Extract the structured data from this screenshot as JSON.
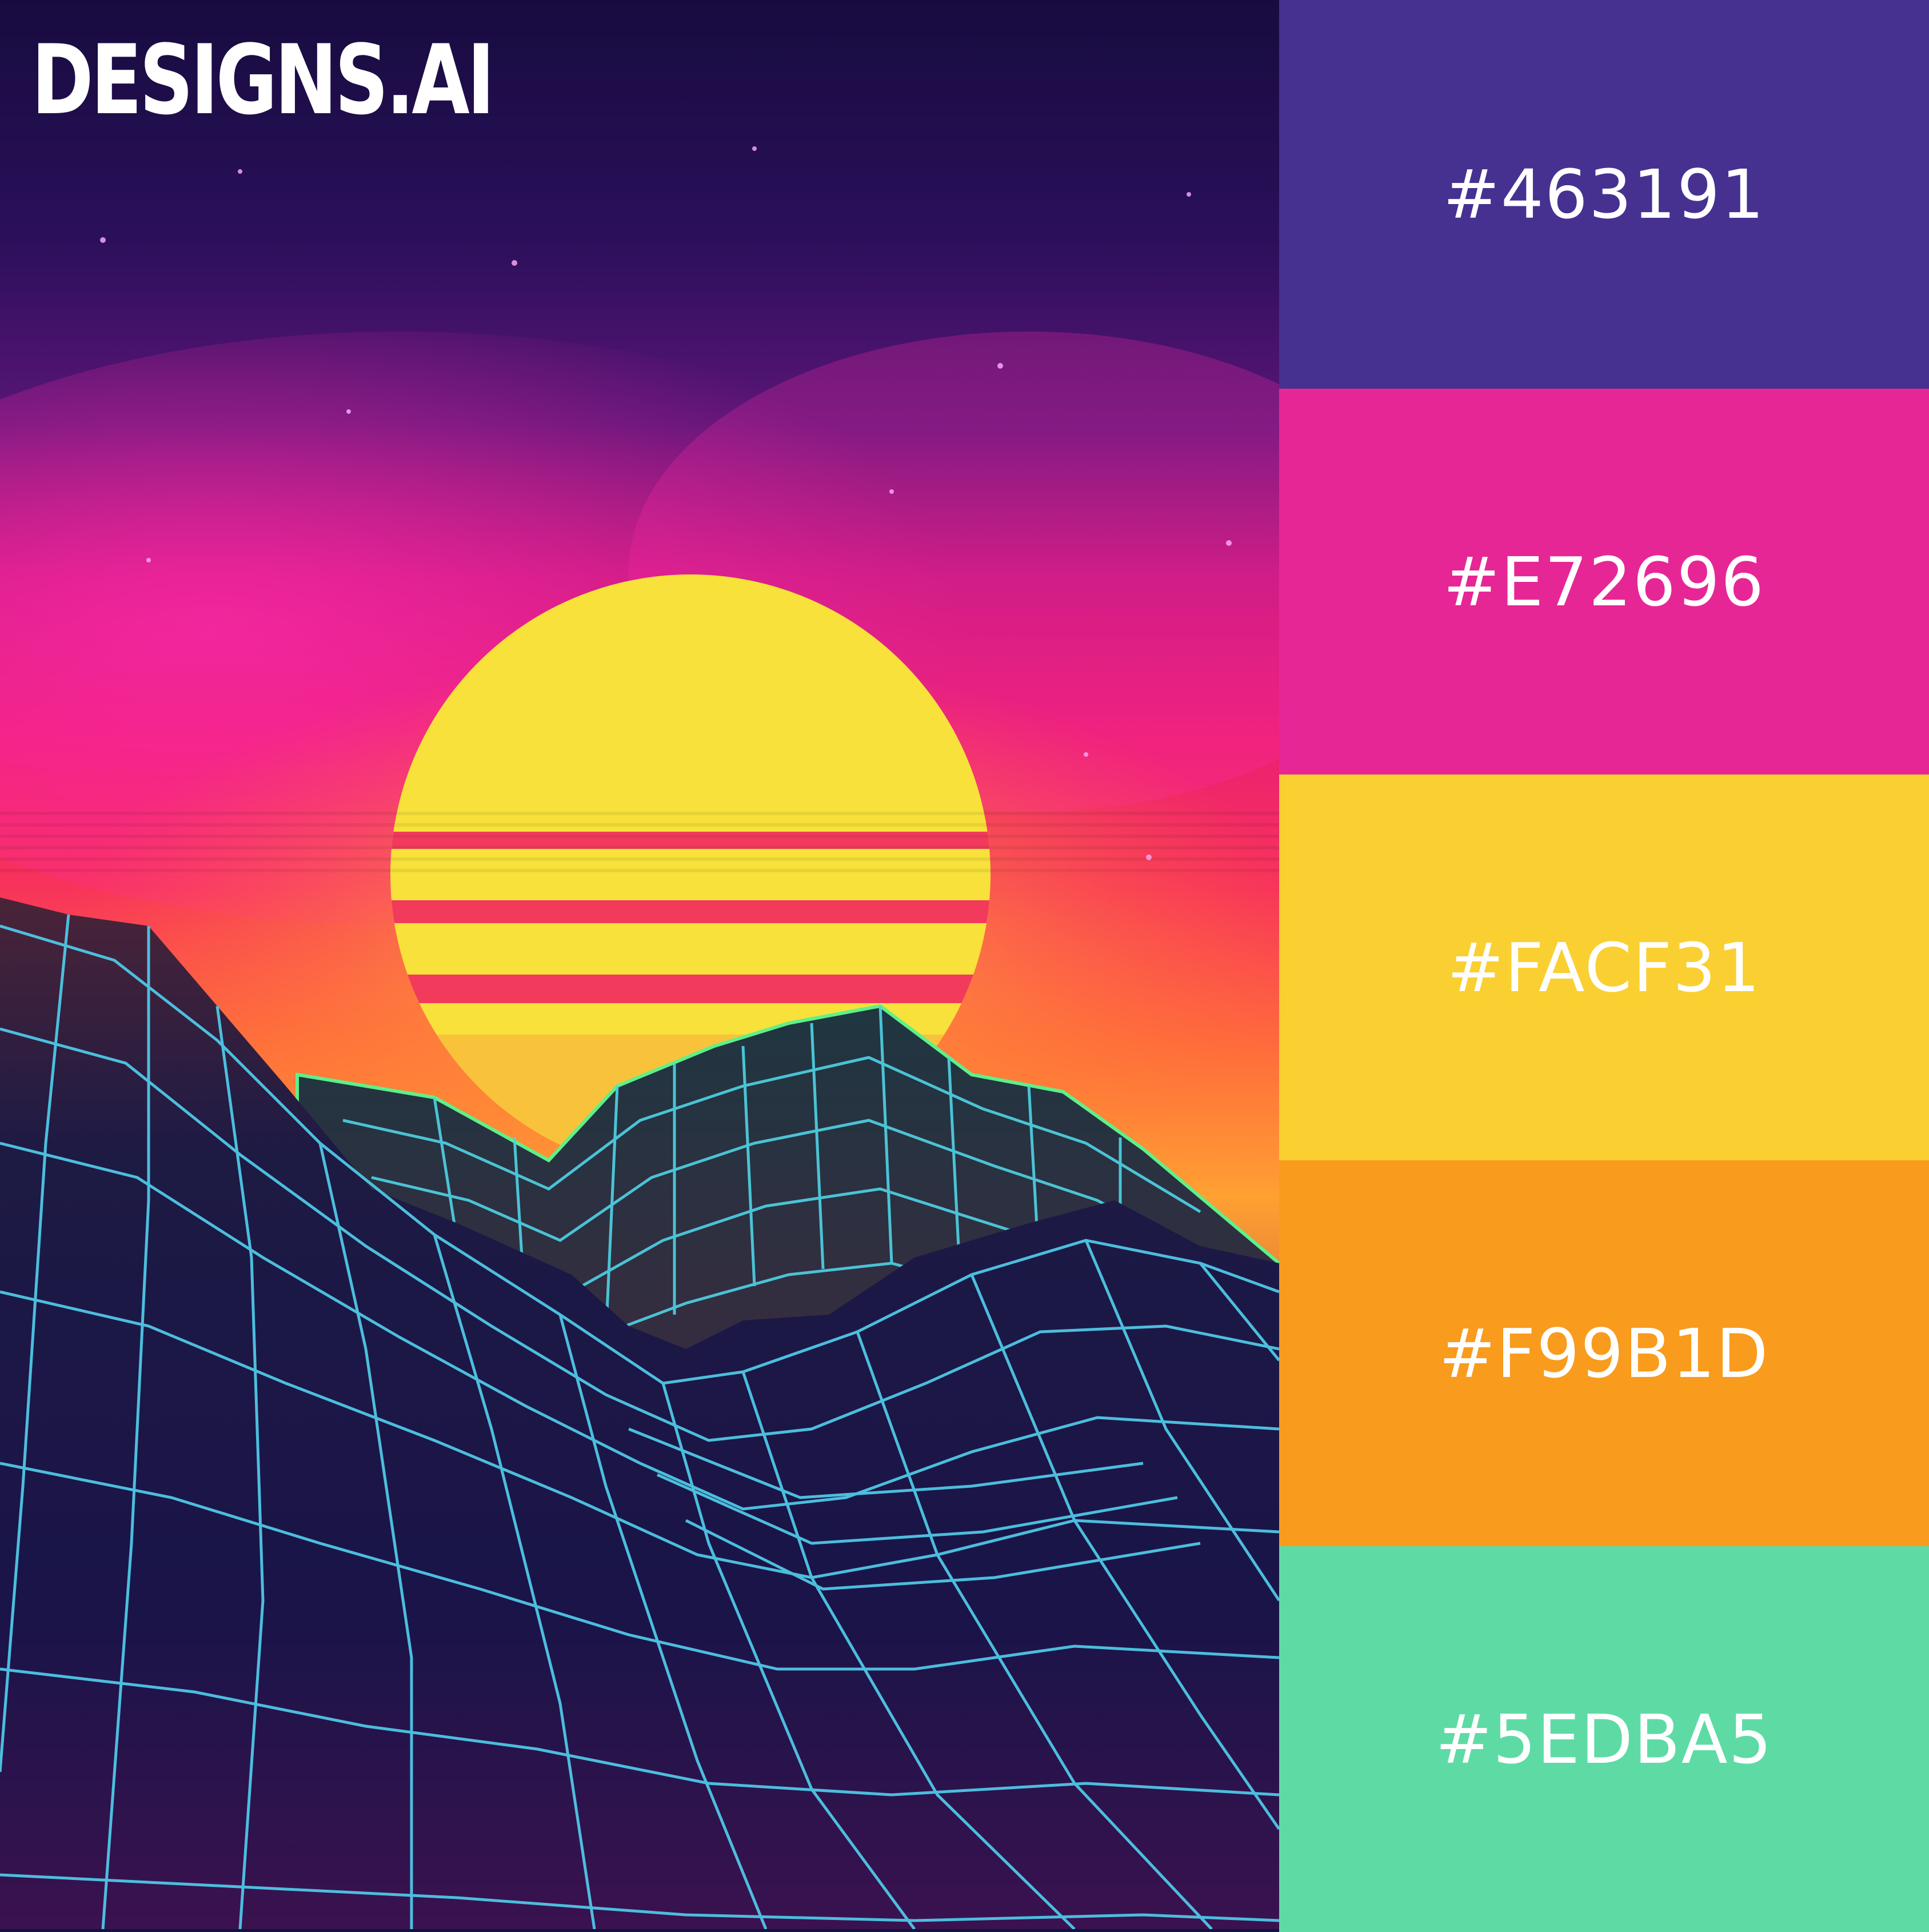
{
  "brand": {
    "logo_text": "DESIGNS.AI",
    "logo_colors": [
      "#F99B1D",
      "#5EDBA5",
      "#E72696",
      "#463191"
    ]
  },
  "artwork": {
    "subject": "synthwave sunset over wireframe mountains",
    "colors": {
      "sky_top": "#1a0f4a",
      "sky_mid": "#e91e73",
      "glow": "#ff9a2e",
      "sun": "#f7e03a",
      "sun_stripe": "#f23a5c",
      "wireframe": "#4fd3e6",
      "ground": "#1b1646"
    }
  },
  "palette": {
    "swatches": [
      {
        "hex": "#463191",
        "label": "#463191"
      },
      {
        "hex": "#E72696",
        "label": "#E72696"
      },
      {
        "hex": "#FACF31",
        "label": "#FACF31"
      },
      {
        "hex": "#F99B1D",
        "label": "#F99B1D"
      },
      {
        "hex": "#5EDBA5",
        "label": "#5EDBA5"
      }
    ]
  }
}
